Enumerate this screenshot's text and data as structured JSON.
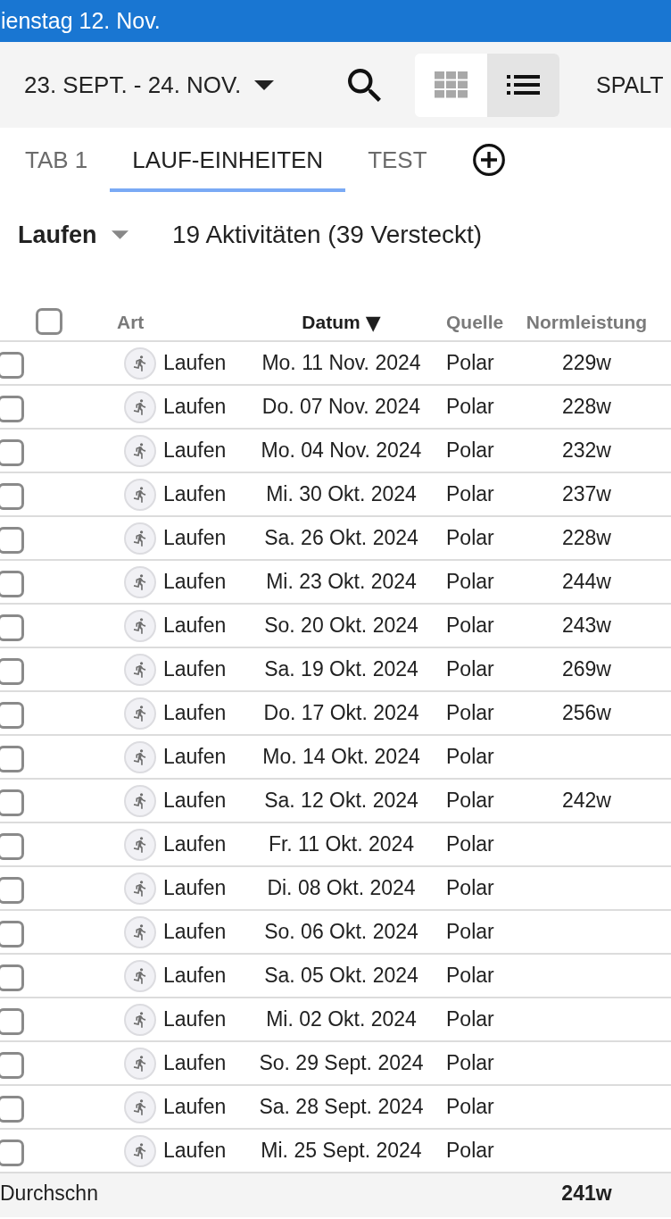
{
  "status_bar": {
    "text": "ienstag 12. Nov."
  },
  "toolbar": {
    "date_range": "23. SEPT. - 24. NOV.",
    "view_toggle": [
      {
        "kind": "grid",
        "selected": false
      },
      {
        "kind": "list",
        "selected": true
      }
    ],
    "columns_button": "SPALT"
  },
  "tabs": [
    {
      "label": "TAB 1",
      "selected": false
    },
    {
      "label": "LAUF-EINHEITEN",
      "selected": true
    },
    {
      "label": "TEST",
      "selected": false
    }
  ],
  "filter": {
    "activity_type": "Laufen",
    "summary": "19 Aktivitäten (39 Versteckt)"
  },
  "table": {
    "select_all": {
      "checked": false
    },
    "columns": [
      {
        "label": "Art"
      },
      {
        "label": "Datum",
        "sort_indicator": "▼"
      },
      {
        "label": "Quelle"
      },
      {
        "label": "Normleistung"
      }
    ],
    "rows": [
      {
        "checked": false,
        "type": "Laufen",
        "date": "Mo. 11 Nov. 2024",
        "source": "Polar",
        "norm_power": "229w"
      },
      {
        "checked": false,
        "type": "Laufen",
        "date": "Do. 07 Nov. 2024",
        "source": "Polar",
        "norm_power": "228w"
      },
      {
        "checked": false,
        "type": "Laufen",
        "date": "Mo. 04 Nov. 2024",
        "source": "Polar",
        "norm_power": "232w"
      },
      {
        "checked": false,
        "type": "Laufen",
        "date": "Mi. 30 Okt. 2024",
        "source": "Polar",
        "norm_power": "237w"
      },
      {
        "checked": false,
        "type": "Laufen",
        "date": "Sa. 26 Okt. 2024",
        "source": "Polar",
        "norm_power": "228w"
      },
      {
        "checked": false,
        "type": "Laufen",
        "date": "Mi. 23 Okt. 2024",
        "source": "Polar",
        "norm_power": "244w"
      },
      {
        "checked": false,
        "type": "Laufen",
        "date": "So. 20 Okt. 2024",
        "source": "Polar",
        "norm_power": "243w"
      },
      {
        "checked": false,
        "type": "Laufen",
        "date": "Sa. 19 Okt. 2024",
        "source": "Polar",
        "norm_power": "269w"
      },
      {
        "checked": false,
        "type": "Laufen",
        "date": "Do. 17 Okt. 2024",
        "source": "Polar",
        "norm_power": "256w"
      },
      {
        "checked": false,
        "type": "Laufen",
        "date": "Mo. 14 Okt. 2024",
        "source": "Polar"
      },
      {
        "checked": false,
        "type": "Laufen",
        "date": "Sa. 12 Okt. 2024",
        "source": "Polar",
        "norm_power": "242w"
      },
      {
        "checked": false,
        "type": "Laufen",
        "date": "Fr. 11 Okt. 2024",
        "source": "Polar"
      },
      {
        "checked": false,
        "type": "Laufen",
        "date": "Di. 08 Okt. 2024",
        "source": "Polar"
      },
      {
        "checked": false,
        "type": "Laufen",
        "date": "So. 06 Okt. 2024",
        "source": "Polar"
      },
      {
        "checked": false,
        "type": "Laufen",
        "date": "Sa. 05 Okt. 2024",
        "source": "Polar"
      },
      {
        "checked": false,
        "type": "Laufen",
        "date": "Mi. 02 Okt. 2024",
        "source": "Polar"
      },
      {
        "checked": false,
        "type": "Laufen",
        "date": "So. 29 Sept. 2024",
        "source": "Polar"
      },
      {
        "checked": false,
        "type": "Laufen",
        "date": "Sa. 28 Sept. 2024",
        "source": "Polar"
      },
      {
        "checked": false,
        "type": "Laufen",
        "date": "Mi. 25 Sept. 2024",
        "source": "Polar"
      }
    ],
    "footer": {
      "label": "Durchschn",
      "norm_power": "241w"
    }
  }
}
